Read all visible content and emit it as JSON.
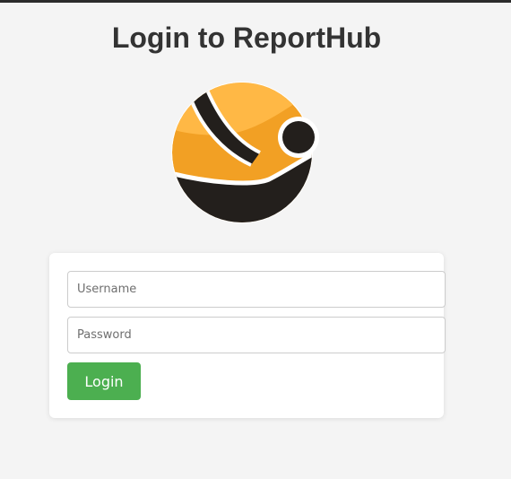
{
  "page": {
    "title": "Login to ReportHub"
  },
  "logo": {
    "icon": "reporthub-logo-icon",
    "colors": {
      "orange": "#f2a024",
      "orange_light": "#ffb845",
      "dark": "#231f1c",
      "white": "#ffffff"
    }
  },
  "login_form": {
    "username_placeholder": "Username",
    "username_value": "",
    "password_placeholder": "Password",
    "password_value": "",
    "submit_label": "Login",
    "submit_color": "#4caf50"
  }
}
